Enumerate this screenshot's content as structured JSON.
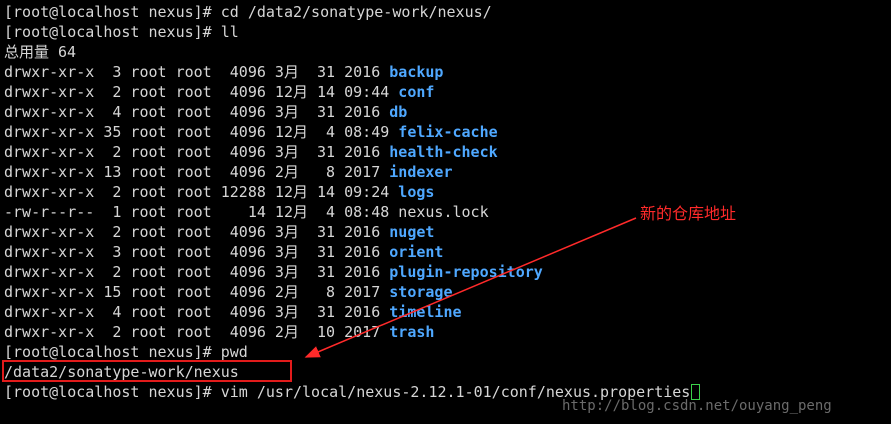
{
  "terminal": {
    "lines": [
      {
        "kind": "prompt",
        "text": "[root@localhost nexus]# cd /data2/sonatype-work/nexus/"
      },
      {
        "kind": "prompt",
        "text": "[root@localhost nexus]# ll"
      },
      {
        "kind": "plain",
        "text": "总用量 64"
      },
      {
        "kind": "entry",
        "prefix": "drwxr-xr-x  3 root root  4096 3月  31 2016 ",
        "name": "backup",
        "type": "dir"
      },
      {
        "kind": "entry",
        "prefix": "drwxr-xr-x  2 root root  4096 12月 14 09:44 ",
        "name": "conf",
        "type": "dir"
      },
      {
        "kind": "entry",
        "prefix": "drwxr-xr-x  4 root root  4096 3月  31 2016 ",
        "name": "db",
        "type": "dir"
      },
      {
        "kind": "entry",
        "prefix": "drwxr-xr-x 35 root root  4096 12月  4 08:49 ",
        "name": "felix-cache",
        "type": "dir"
      },
      {
        "kind": "entry",
        "prefix": "drwxr-xr-x  2 root root  4096 3月  31 2016 ",
        "name": "health-check",
        "type": "dir"
      },
      {
        "kind": "entry",
        "prefix": "drwxr-xr-x 13 root root  4096 2月   8 2017 ",
        "name": "indexer",
        "type": "dir"
      },
      {
        "kind": "entry",
        "prefix": "drwxr-xr-x  2 root root 12288 12月 14 09:24 ",
        "name": "logs",
        "type": "dir"
      },
      {
        "kind": "entry",
        "prefix": "-rw-r--r--  1 root root    14 12月  4 08:48 ",
        "name": "nexus.lock",
        "type": "file"
      },
      {
        "kind": "entry",
        "prefix": "drwxr-xr-x  2 root root  4096 3月  31 2016 ",
        "name": "nuget",
        "type": "dir"
      },
      {
        "kind": "entry",
        "prefix": "drwxr-xr-x  3 root root  4096 3月  31 2016 ",
        "name": "orient",
        "type": "dir"
      },
      {
        "kind": "entry",
        "prefix": "drwxr-xr-x  2 root root  4096 3月  31 2016 ",
        "name": "plugin-repository",
        "type": "dir"
      },
      {
        "kind": "entry",
        "prefix": "drwxr-xr-x 15 root root  4096 2月   8 2017 ",
        "name": "storage",
        "type": "dir"
      },
      {
        "kind": "entry",
        "prefix": "drwxr-xr-x  4 root root  4096 3月  31 2016 ",
        "name": "timeline",
        "type": "dir"
      },
      {
        "kind": "entry",
        "prefix": "drwxr-xr-x  2 root root  4096 2月  10 2017 ",
        "name": "trash",
        "type": "dir"
      },
      {
        "kind": "prompt",
        "text": "[root@localhost nexus]# pwd"
      },
      {
        "kind": "plain",
        "text": "/data2/sonatype-work/nexus"
      },
      {
        "kind": "input",
        "text": "[root@localhost nexus]# vim /usr/local/nexus-2.12.1-01/conf/nexus.properties"
      }
    ]
  },
  "annotation": {
    "text": "新的仓库地址"
  },
  "watermark": {
    "text": "http://blog.csdn.net/ouyang_peng"
  },
  "colors": {
    "background": "#000000",
    "text": "#d6d6d6",
    "directory": "#4fa8ff",
    "annotation": "#ff2a2a",
    "cursor": "#3bd14a"
  }
}
